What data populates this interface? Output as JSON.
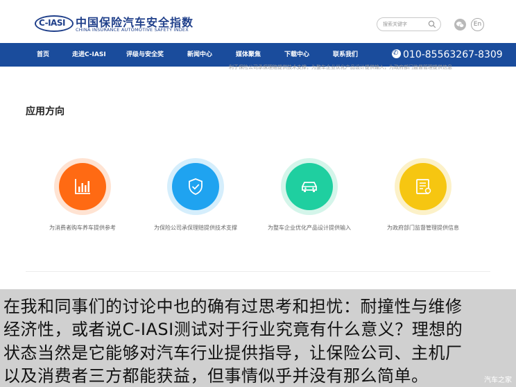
{
  "header": {
    "logo_ciasi": "C-IASI",
    "logo_cn": "中国保险汽车安全指数",
    "logo_en": "CHINA INSURANCE AUTOMOTIVE SAFETY INDEX",
    "search_placeholder": "搜索关键字",
    "lang_label": "En"
  },
  "nav": {
    "items": [
      "首页",
      "走进C-IASI",
      "评级与安全奖",
      "新闻中心",
      "媒体聚焦",
      "下载中心",
      "联系我们"
    ],
    "phone": "010-85563267-8309"
  },
  "overflow_text": "利于保险公司承保理赔提供技术支撑，为整车企业优化产品设计提供输入，为政府部门监督管理提供信息",
  "section": {
    "title": "应用方向",
    "features": [
      {
        "label": "为消费者购车养车提供参考",
        "icon": "bar-chart-icon",
        "color": "#ff6a13",
        "ring": "#ffe3d2"
      },
      {
        "label": "为保险公司承保理赔提供技术支撑",
        "icon": "shield-check-icon",
        "color": "#1fa3f0",
        "ring": "#d5eefc"
      },
      {
        "label": "为整车企业优化产品设计提供输入",
        "icon": "car-icon",
        "color": "#1fcfa0",
        "ring": "#d4f5ea"
      },
      {
        "label": "为政府部门监督管理提供信息",
        "icon": "report-icon",
        "color": "#f6c611",
        "ring": "#fcf1c8"
      }
    ]
  },
  "caption": {
    "lines": [
      "在我和同事们的讨论中也的确有过思考和担忧：耐撞性与维修",
      "经济性，或者说C-IASI测试对于行业究竟有什么意义？理想的",
      "状态当然是它能够对汽车行业提供指导，让保险公司、主机厂",
      "以及消费者三方都能获益，但事情似乎并没有那么简单。"
    ],
    "watermark": "汽车之家"
  }
}
